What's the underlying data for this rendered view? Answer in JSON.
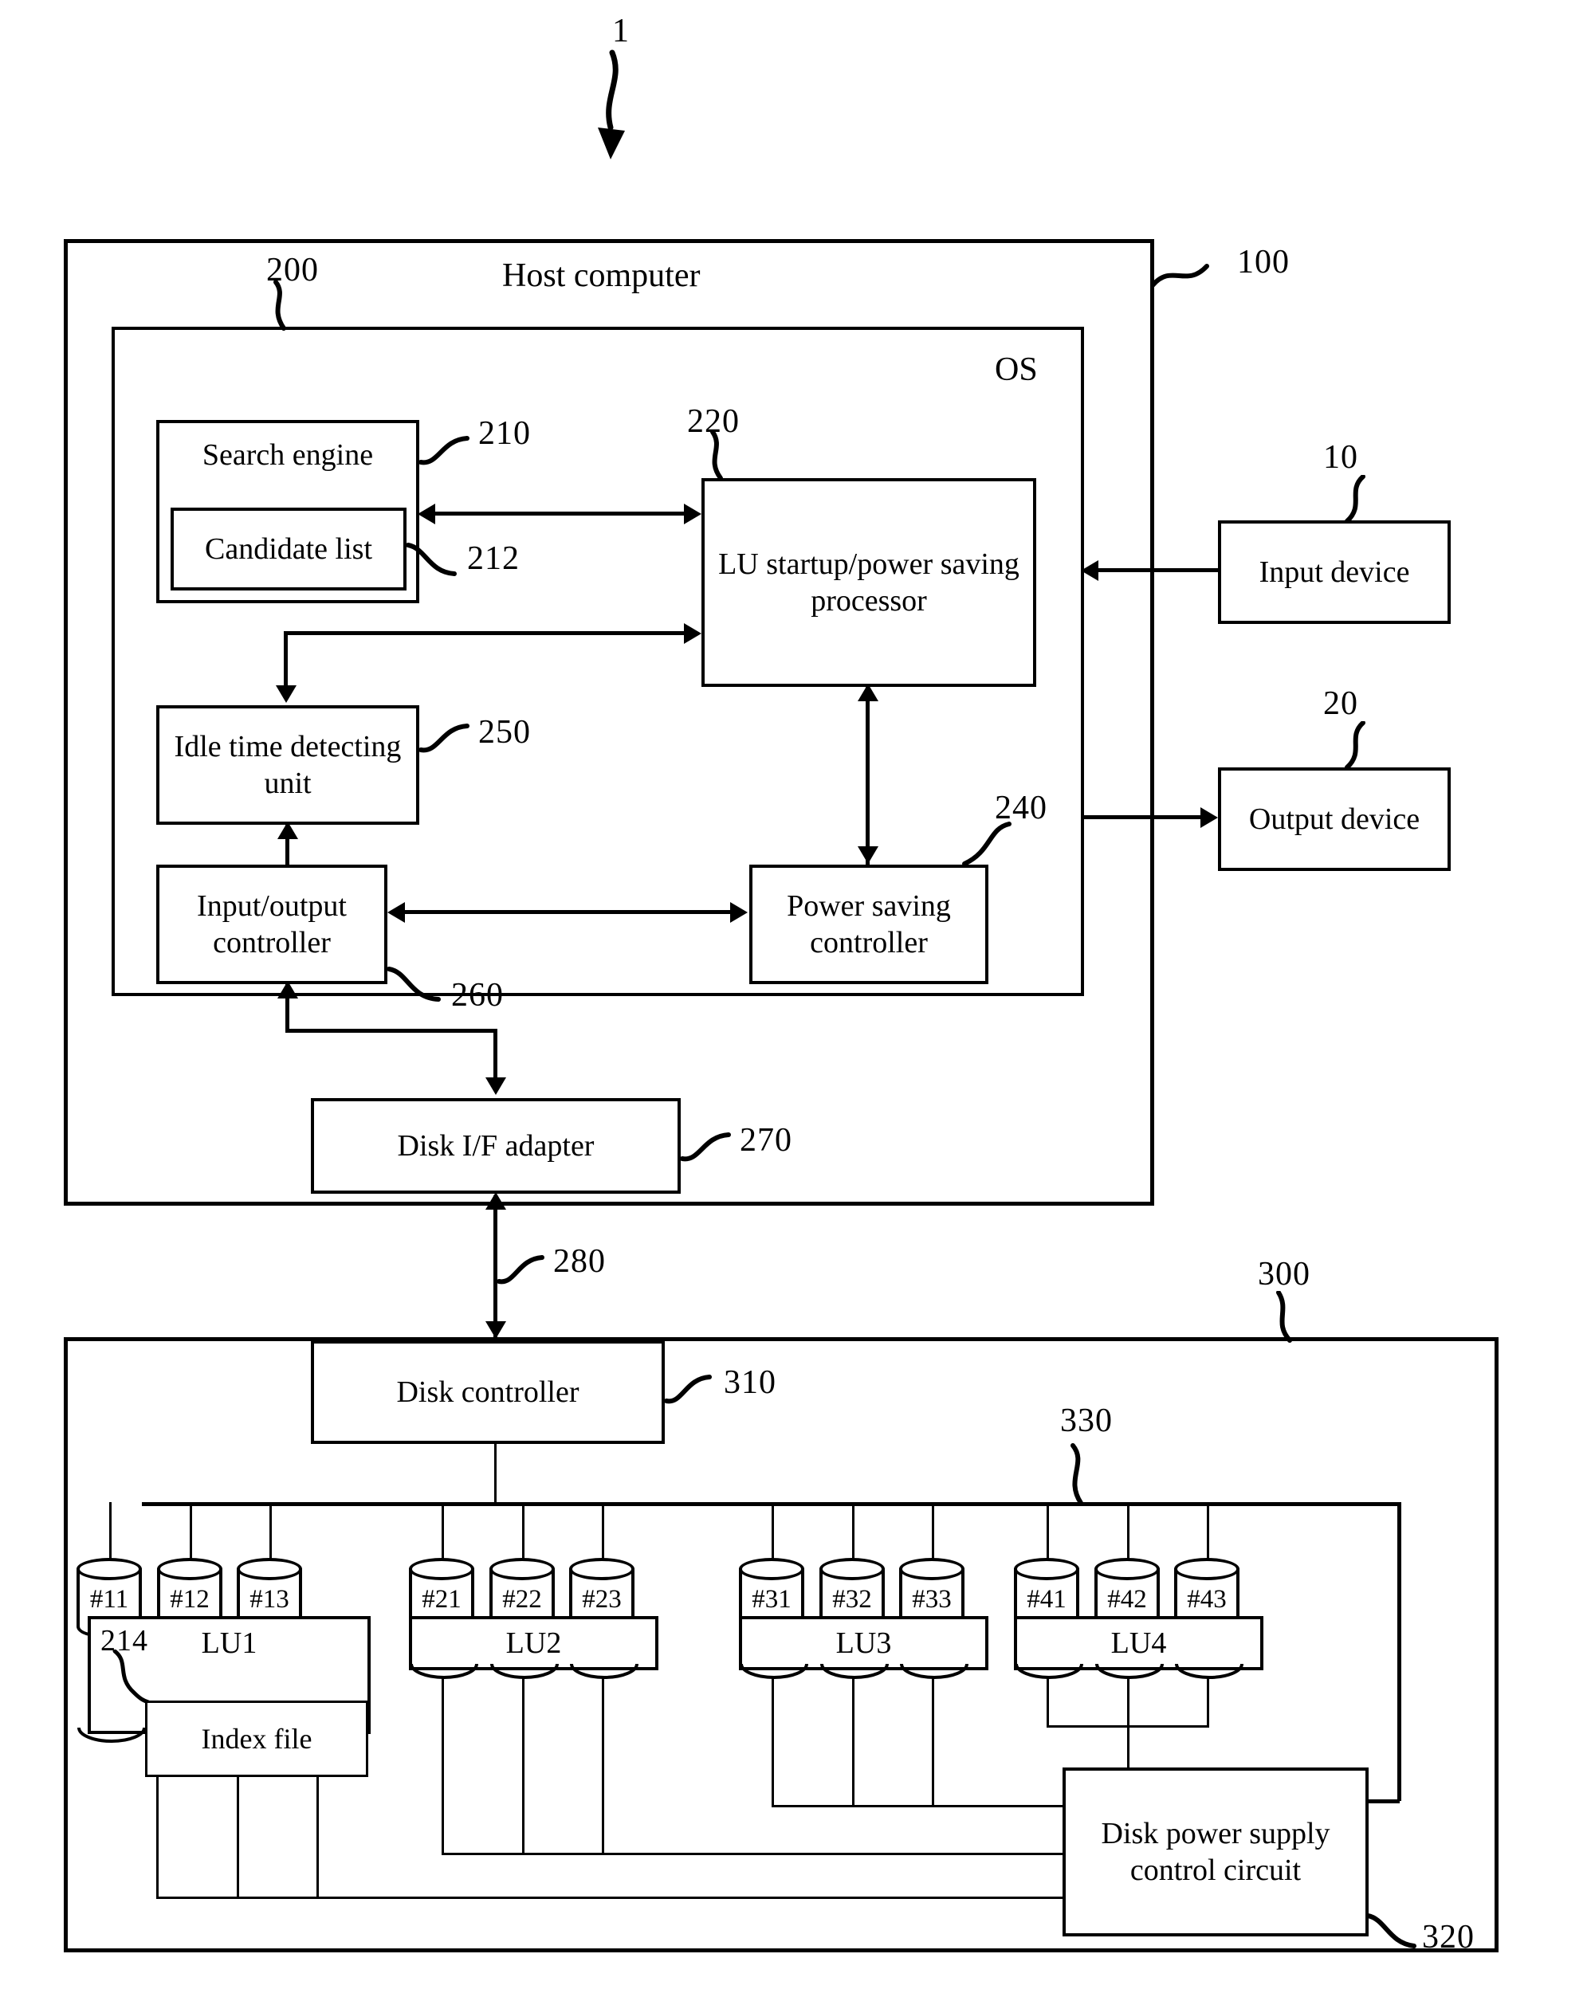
{
  "figure": {
    "top_ref": "1"
  },
  "host": {
    "ref": "100",
    "title": "Host computer",
    "os": {
      "ref": "200",
      "label": "OS"
    },
    "blocks": {
      "search_engine": {
        "label": "Search engine",
        "ref": "210"
      },
      "candidate_list": {
        "label": "Candidate list",
        "ref": "212"
      },
      "lu_processor": {
        "label": "LU startup/power saving processor",
        "ref": "220"
      },
      "idle_time": {
        "label": "Idle time detecting unit",
        "ref": "250"
      },
      "io_controller": {
        "label": "Input/output controller",
        "ref": "260"
      },
      "power_saving": {
        "label": "Power saving controller",
        "ref": "240"
      },
      "disk_if_adapter": {
        "label": "Disk I/F adapter",
        "ref": "270"
      }
    },
    "bus": {
      "ref": "280"
    }
  },
  "peripherals": {
    "input_device": {
      "label": "Input device",
      "ref": "10"
    },
    "output_device": {
      "label": "Output device",
      "ref": "20"
    }
  },
  "storage": {
    "ref": "300",
    "disk_controller": {
      "label": "Disk controller",
      "ref": "310"
    },
    "disk_bus": {
      "ref": "330"
    },
    "power_circuit": {
      "label": "Disk power supply control circuit",
      "ref": "320"
    },
    "index_file": {
      "label": "Index file",
      "ref": "214"
    },
    "logical_units": [
      {
        "name": "LU1",
        "disks": [
          "#11",
          "#12",
          "#13"
        ]
      },
      {
        "name": "LU2",
        "disks": [
          "#21",
          "#22",
          "#23"
        ]
      },
      {
        "name": "LU3",
        "disks": [
          "#31",
          "#32",
          "#33"
        ]
      },
      {
        "name": "LU4",
        "disks": [
          "#41",
          "#42",
          "#43"
        ]
      }
    ]
  }
}
